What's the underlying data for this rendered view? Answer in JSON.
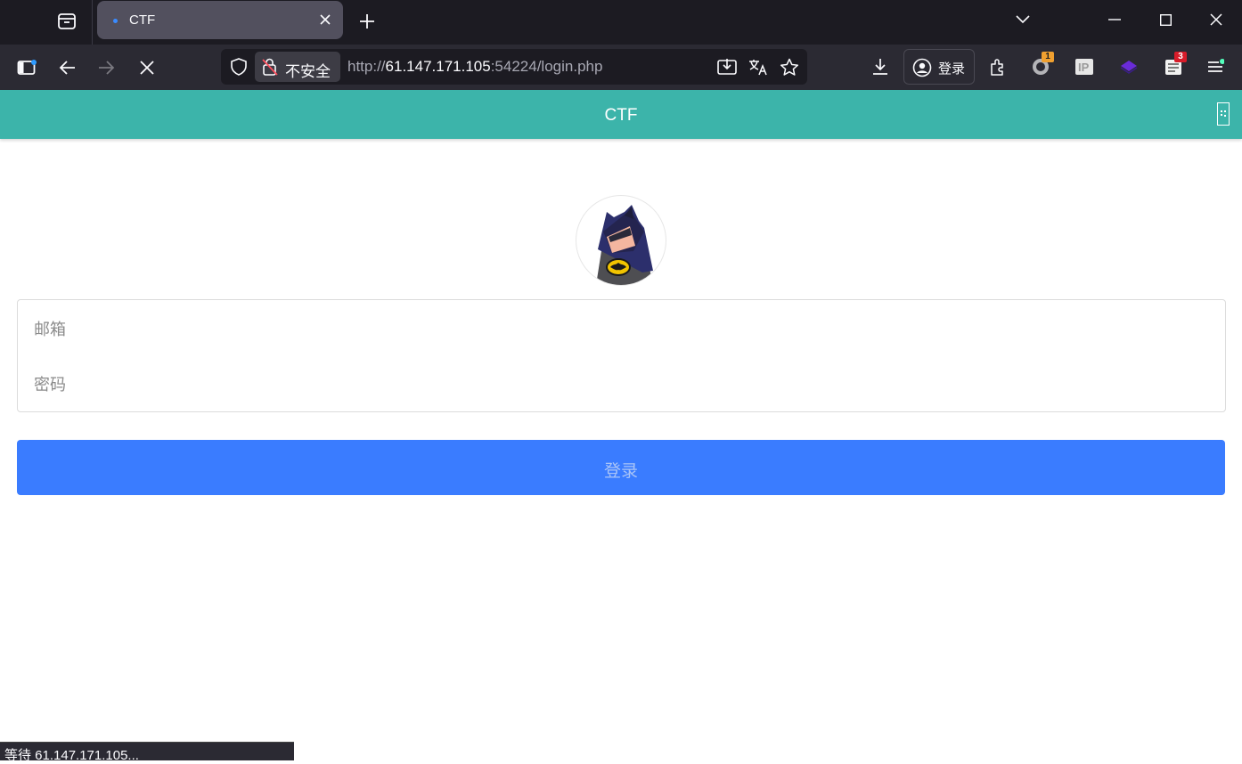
{
  "browser": {
    "tab": {
      "title": "CTF"
    },
    "address_bar": {
      "security_label": "不安全",
      "url_scheme": "http://",
      "url_host": "61.147.171.105",
      "url_rest": ":54224/login.php"
    },
    "account_label": "登录",
    "extension_badges": [
      "1",
      "3"
    ],
    "status_text": "等待 61.147.171.105..."
  },
  "app": {
    "header_title": "CTF",
    "avatar": "batman-avatar",
    "form": {
      "email_placeholder": "邮箱",
      "password_placeholder": "密码",
      "submit_label": "登录"
    }
  },
  "colors": {
    "header": "#3cb4aa",
    "button": "#3a7cff"
  }
}
